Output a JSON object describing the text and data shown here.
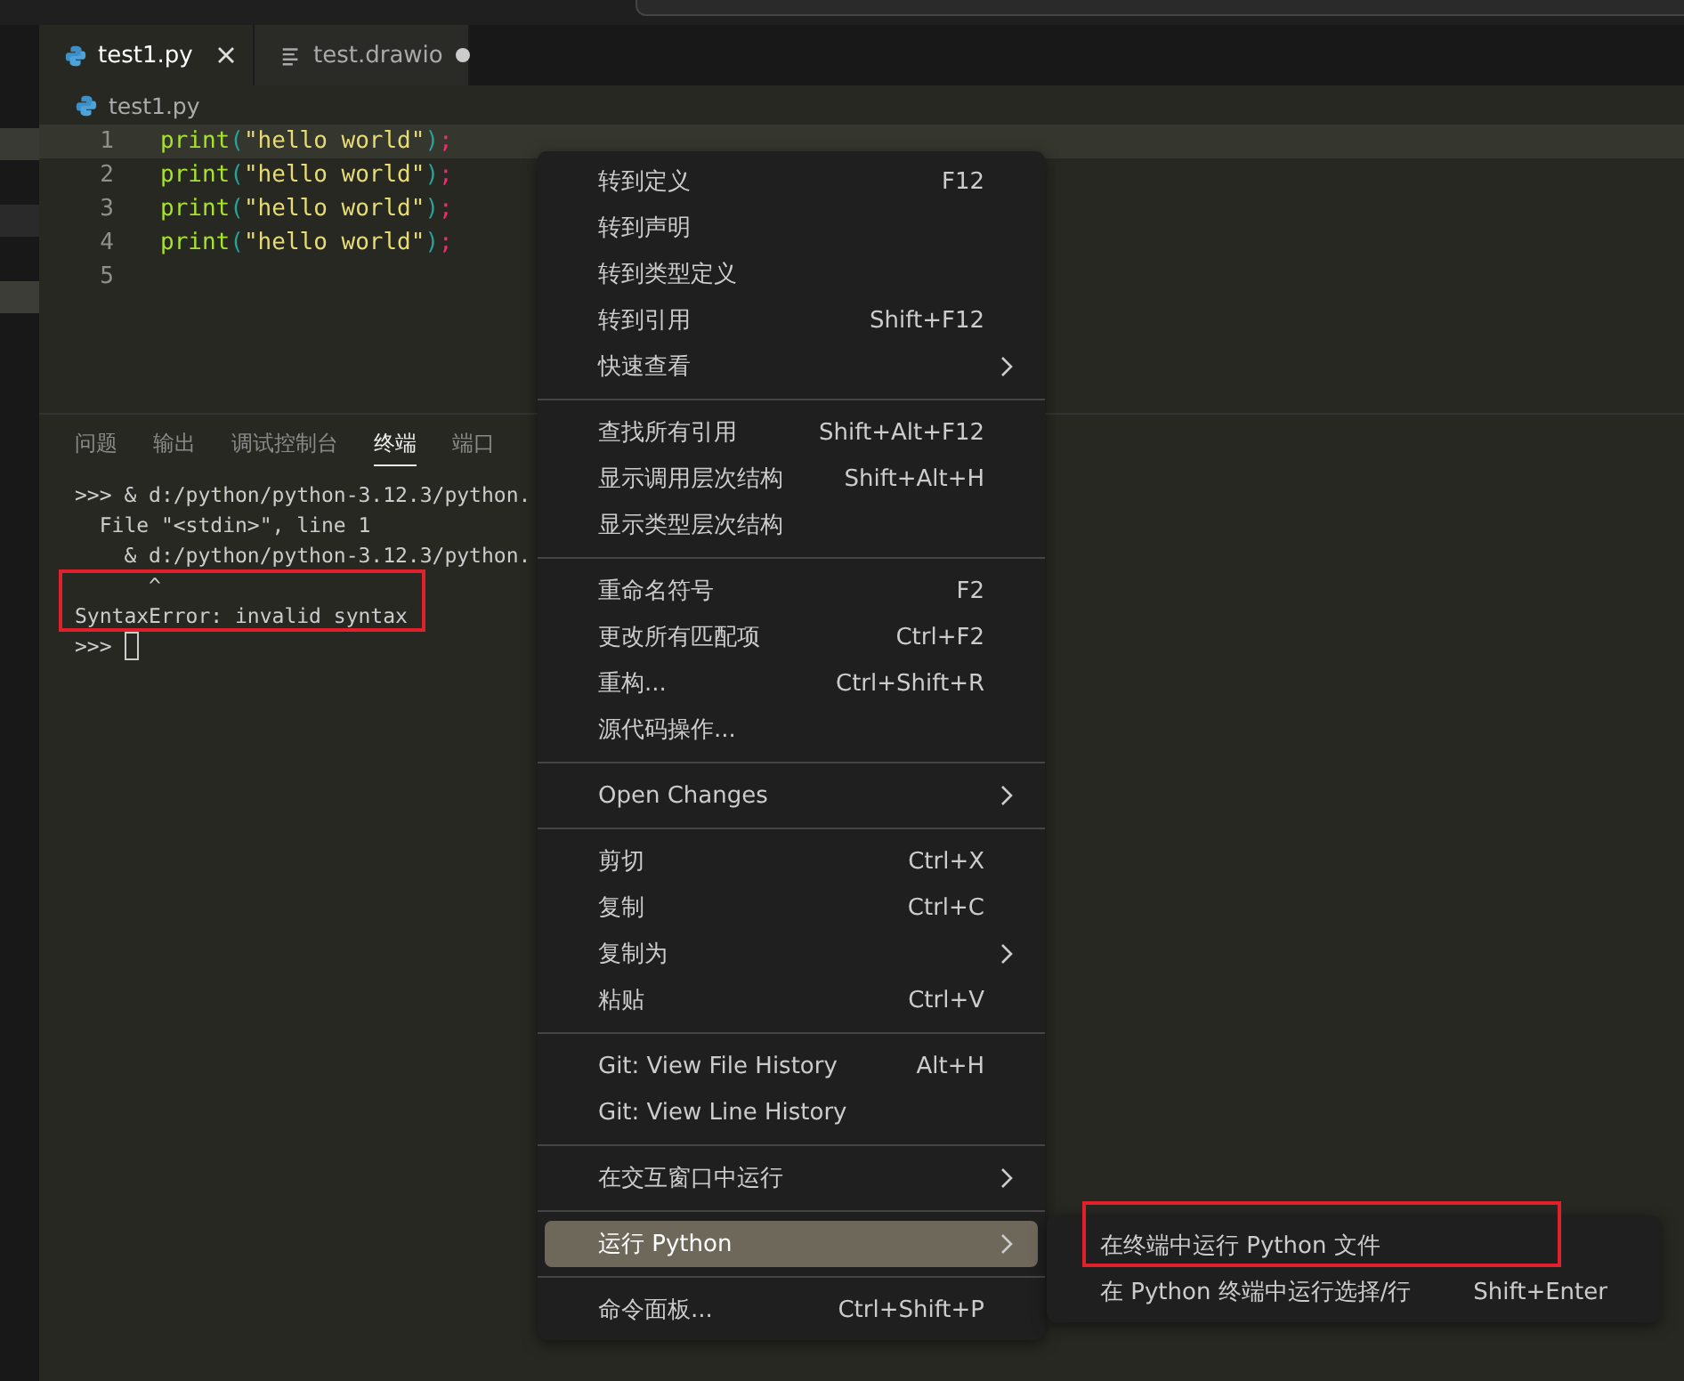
{
  "tabs": [
    {
      "label": "test1.py",
      "selected": true,
      "modified": false
    },
    {
      "label": "test.drawio",
      "selected": false,
      "modified": true
    }
  ],
  "breadcrumb": "test1.py",
  "editor": {
    "lines": [
      {
        "number": "1",
        "func": "print",
        "open": "(",
        "string": "\"hello world\"",
        "close": ")",
        "end": ";",
        "current": true
      },
      {
        "number": "2",
        "func": "print",
        "open": "(",
        "string": "\"hello world\"",
        "close": ")",
        "end": ";",
        "current": false
      },
      {
        "number": "3",
        "func": "print",
        "open": "(",
        "string": "\"hello world\"",
        "close": ")",
        "end": ";",
        "current": false
      },
      {
        "number": "4",
        "func": "print",
        "open": "(",
        "string": "\"hello world\"",
        "close": ")",
        "end": ";",
        "current": false
      },
      {
        "number": "5",
        "current": false
      }
    ]
  },
  "panel": {
    "tabs": [
      {
        "label": "问题",
        "selected": false
      },
      {
        "label": "输出",
        "selected": false
      },
      {
        "label": "调试控制台",
        "selected": false
      },
      {
        "label": "终端",
        "selected": true
      },
      {
        "label": "端口",
        "selected": false
      }
    ],
    "terminal": [
      {
        "text": ">>> & d:/python/python-3.12.3/python.",
        "highlighted": false
      },
      {
        "text": "  File \"<stdin>\", line 1",
        "highlighted": false
      },
      {
        "text": "    & d:/python/python-3.12.3/python.",
        "highlighted": false
      },
      {
        "text": "      ^",
        "highlighted": true
      },
      {
        "text": "SyntaxError: invalid syntax",
        "highlighted": true
      },
      {
        "text": ">>> ",
        "highlighted": false,
        "cursor": true
      }
    ]
  },
  "context_menu": [
    {
      "kind": "item",
      "label": "转到定义",
      "shortcut": "F12",
      "submenu": false,
      "selected": false
    },
    {
      "kind": "item",
      "label": "转到声明",
      "submenu": false,
      "selected": false
    },
    {
      "kind": "item",
      "label": "转到类型定义",
      "submenu": false,
      "selected": false
    },
    {
      "kind": "item",
      "label": "转到引用",
      "shortcut": "Shift+F12",
      "submenu": false,
      "selected": false
    },
    {
      "kind": "item",
      "label": "快速查看",
      "submenu": true,
      "selected": false
    },
    {
      "kind": "separator"
    },
    {
      "kind": "item",
      "label": "查找所有引用",
      "shortcut": "Shift+Alt+F12",
      "submenu": false,
      "selected": false
    },
    {
      "kind": "item",
      "label": "显示调用层次结构",
      "shortcut": "Shift+Alt+H",
      "submenu": false,
      "selected": false
    },
    {
      "kind": "item",
      "label": "显示类型层次结构",
      "submenu": false,
      "selected": false
    },
    {
      "kind": "separator"
    },
    {
      "kind": "item",
      "label": "重命名符号",
      "shortcut": "F2",
      "submenu": false,
      "selected": false
    },
    {
      "kind": "item",
      "label": "更改所有匹配项",
      "shortcut": "Ctrl+F2",
      "submenu": false,
      "selected": false
    },
    {
      "kind": "item",
      "label": "重构...",
      "shortcut": "Ctrl+Shift+R",
      "submenu": false,
      "selected": false
    },
    {
      "kind": "item",
      "label": "源代码操作...",
      "submenu": false,
      "selected": false
    },
    {
      "kind": "separator"
    },
    {
      "kind": "item",
      "label": "Open Changes",
      "submenu": true,
      "selected": false
    },
    {
      "kind": "separator"
    },
    {
      "kind": "item",
      "label": "剪切",
      "shortcut": "Ctrl+X",
      "submenu": false,
      "selected": false
    },
    {
      "kind": "item",
      "label": "复制",
      "shortcut": "Ctrl+C",
      "submenu": false,
      "selected": false
    },
    {
      "kind": "item",
      "label": "复制为",
      "submenu": true,
      "selected": false
    },
    {
      "kind": "item",
      "label": "粘贴",
      "shortcut": "Ctrl+V",
      "submenu": false,
      "selected": false
    },
    {
      "kind": "separator"
    },
    {
      "kind": "item",
      "label": "Git: View File History",
      "shortcut": "Alt+H",
      "submenu": false,
      "selected": false
    },
    {
      "kind": "item",
      "label": "Git: View Line History",
      "submenu": false,
      "selected": false
    },
    {
      "kind": "separator"
    },
    {
      "kind": "item",
      "label": "在交互窗口中运行",
      "submenu": true,
      "selected": false
    },
    {
      "kind": "separator"
    },
    {
      "kind": "item",
      "label": "运行 Python",
      "submenu": true,
      "selected": true
    },
    {
      "kind": "separator"
    },
    {
      "kind": "item",
      "label": "命令面板...",
      "shortcut": "Ctrl+Shift+P",
      "submenu": false,
      "selected": false
    }
  ],
  "submenu": [
    {
      "label": "在终端中运行 Python 文件",
      "highlighted": true
    },
    {
      "label": "在 Python 终端中运行选择/行",
      "shortcut": "Shift+Enter",
      "highlighted": false
    }
  ]
}
